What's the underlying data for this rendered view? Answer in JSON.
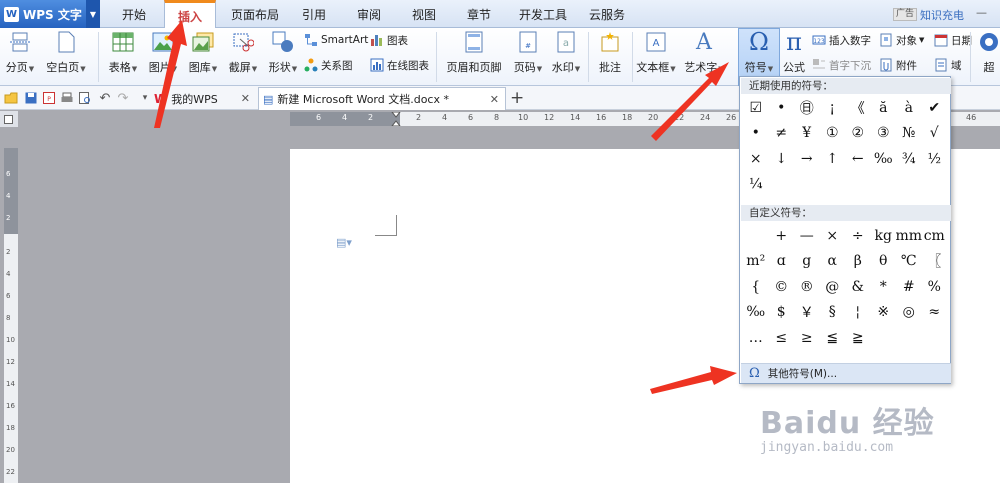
{
  "app": {
    "logo": "W",
    "name": "WPS 文字"
  },
  "menu_tabs": [
    "开始",
    "插入",
    "页面布局",
    "引用",
    "审阅",
    "视图",
    "章节",
    "开发工具",
    "云服务"
  ],
  "active_tab": "插入",
  "ad": {
    "badge": "广告",
    "text": "知识充电"
  },
  "ribbon": {
    "paging": "分页",
    "blank_page": "空白页",
    "table": "表格",
    "picture": "图片",
    "gallery": "图库",
    "screenshot": "截屏",
    "shape": "形状",
    "smartart": "SmartArt",
    "chart": "图表",
    "relation": "关系图",
    "online_chart": "在线图表",
    "header_footer": "页眉和页脚",
    "page_number": "页码",
    "watermark": "水印",
    "comment": "批注",
    "textbox": "文本框",
    "wordart": "艺术字",
    "symbol": "符号",
    "formula": "公式",
    "insert_number": "插入数字",
    "dropcap": "首字下沉",
    "object": "对象",
    "attachment": "附件",
    "date": "日期",
    "field": "域",
    "hyperlink": "超"
  },
  "doc_tabs": {
    "home": "我的WPS",
    "doc": "新建 Microsoft Word 文档.docx *"
  },
  "ruler": {
    "h_left": [
      "6",
      "4",
      "2"
    ],
    "h_right": [
      "2",
      "4",
      "6",
      "8",
      "10",
      "12",
      "14",
      "16",
      "18",
      "20",
      "22",
      "24",
      "26",
      "28",
      "30",
      "32",
      "34",
      "36",
      "38"
    ],
    "h_end": "46",
    "v_top": [
      "6",
      "4",
      "2"
    ],
    "v_page": [
      "2",
      "4",
      "6",
      "8",
      "10",
      "12",
      "14",
      "16",
      "18",
      "20",
      "22",
      "24",
      "26"
    ]
  },
  "symbol_menu": {
    "recent_header": "近期使用的符号：",
    "recent_symbols": [
      "☑",
      "•",
      "㊐",
      "¡",
      "《",
      "ă",
      "à",
      "✔",
      "•",
      "≠",
      "¥",
      "①",
      "②",
      "③",
      "№",
      "√",
      "×",
      "↓",
      "→",
      "↑",
      "←",
      "‰",
      "¾",
      "½",
      "¼"
    ],
    "custom_header": "自定义符号：",
    "custom_symbols": [
      "",
      "+",
      "—",
      "×",
      "÷",
      "kg",
      "mm",
      "cm",
      "m²",
      "ɑ",
      "g",
      "α",
      "β",
      "θ",
      "℃",
      "〖",
      "{",
      "©",
      "®",
      "@",
      "&",
      "*",
      "#",
      "%",
      "‰",
      "$",
      "￥",
      "§",
      "¦",
      "※",
      "◎",
      "≈",
      "…",
      "≤",
      "≥",
      "≦",
      "≧"
    ],
    "more_label": "其他符号(M)..."
  },
  "watermark": {
    "main": "Baidu 经验",
    "sub": "jingyan.baidu.com"
  }
}
